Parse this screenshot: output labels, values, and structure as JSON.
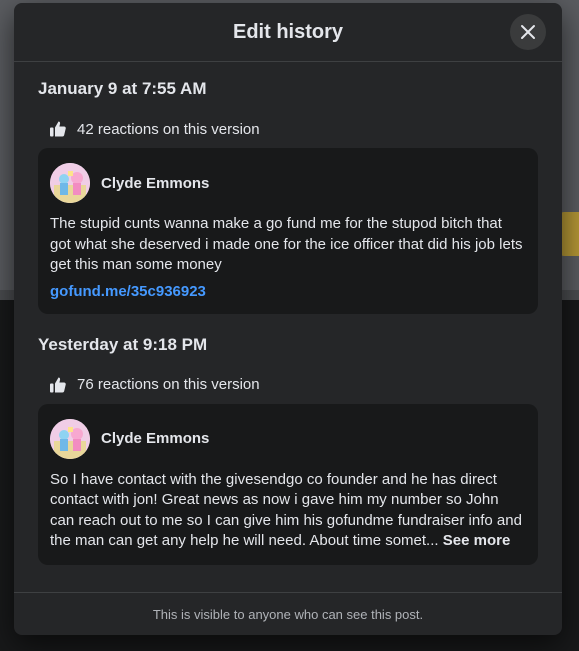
{
  "modal": {
    "title": "Edit history",
    "close_icon": "close-icon",
    "footer_note": "This is visible to anyone who can see this post."
  },
  "versions": [
    {
      "date": "January 9 at 7:55 AM",
      "reactions": "42 reactions on this version",
      "author": "Clyde Emmons",
      "text": "The stupid cunts wanna make a go fund me for the stupod bitch that got what she deserved i made one for the ice officer that did his job lets get this man some money",
      "link": "gofund.me/35c936923"
    },
    {
      "date": "Yesterday at 9:18 PM",
      "reactions": "76 reactions on this version",
      "author": "Clyde Emmons",
      "text": "So I have contact with the givesendgo co founder and he has direct contact with jon! Great news as now i gave him my number so John can reach out to me so I can give him his gofundme fundraiser info and the man can get any help he will need. About time somet...",
      "see_more": "See more"
    }
  ],
  "icons": {
    "reaction": "like-icon",
    "close": "close-icon"
  },
  "colors": {
    "modal_bg": "#252628",
    "card_bg": "#18191a",
    "link": "#4599ff",
    "text": "#e4e6eb",
    "muted": "#b0b3b8"
  }
}
